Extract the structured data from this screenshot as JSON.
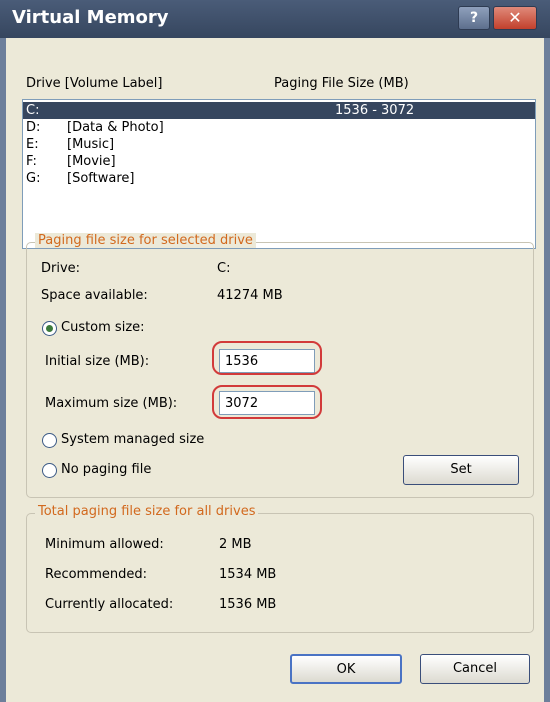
{
  "window": {
    "title": "Virtual Memory"
  },
  "titlebar": {
    "help_glyph": "?",
    "close_glyph": "✕"
  },
  "drives": {
    "header_drive": "Drive  [Volume Label]",
    "header_size": "Paging File Size (MB)",
    "rows": [
      {
        "letter": "C:",
        "label": "",
        "size": "1536 - 3072",
        "selected": true
      },
      {
        "letter": "D:",
        "label": "[Data & Photo]",
        "size": ""
      },
      {
        "letter": "E:",
        "label": "[Music]",
        "size": ""
      },
      {
        "letter": "F:",
        "label": "[Movie]",
        "size": ""
      },
      {
        "letter": "G:",
        "label": "[Software]",
        "size": ""
      }
    ]
  },
  "selected_drive": {
    "legend": "Paging file size for selected drive",
    "drive_label": "Drive:",
    "drive_value": "C:",
    "space_label": "Space available:",
    "space_value": "41274 MB",
    "custom_label": "Custom size:",
    "initial_label": "Initial size (MB):",
    "initial_value": "1536",
    "maximum_label": "Maximum size (MB):",
    "maximum_value": "3072",
    "system_label": "System managed size",
    "none_label": "No paging file",
    "set_label": "Set"
  },
  "totals": {
    "legend": "Total paging file size for all drives",
    "min_label": "Minimum allowed:",
    "min_value": "2 MB",
    "rec_label": "Recommended:",
    "rec_value": "1534 MB",
    "alloc_label": "Currently allocated:",
    "alloc_value": "1536 MB"
  },
  "footer": {
    "ok_label": "OK",
    "cancel_label": "Cancel"
  },
  "colors": {
    "titlebar": "#36465f",
    "selection": "#36465f",
    "legend": "#d2691e",
    "highlight": "#d23a3a",
    "dialog": "#ece9d8"
  }
}
